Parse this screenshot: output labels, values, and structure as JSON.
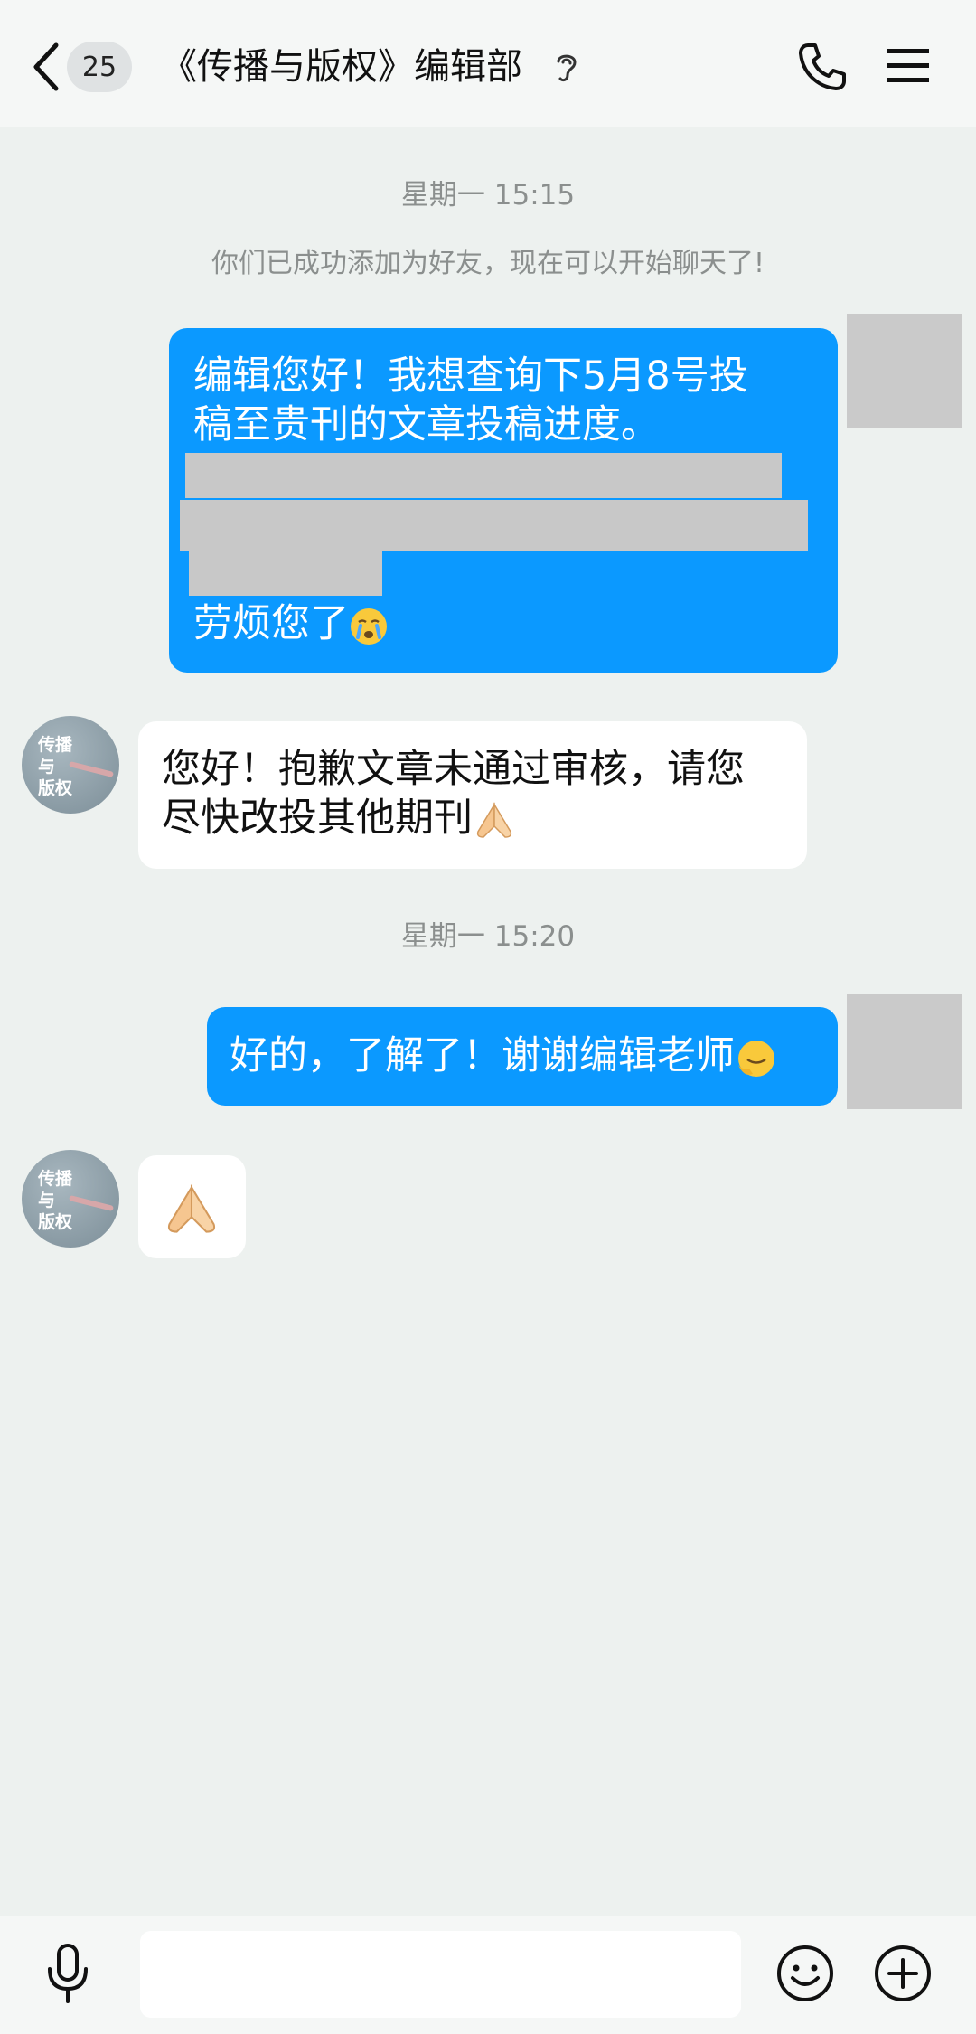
{
  "header": {
    "unread_count": "25",
    "title": "《传播与版权》编辑部"
  },
  "messages": [
    {
      "type": "timestamp",
      "text": "星期一 15:15"
    },
    {
      "type": "system",
      "text": "你们已成功添加为好友，现在可以开始聊天了!"
    },
    {
      "type": "outgoing",
      "lines": [
        "编辑您好！我想查询下5月8号投",
        "稿至贵刊的文章投稿进度。"
      ],
      "closing": "劳烦您了",
      "emoji": "crying-face"
    },
    {
      "type": "incoming",
      "sender_avatar_text": [
        "传播",
        "与",
        "版权"
      ],
      "lines": [
        "您好！抱歉文章未通过审核，请您",
        "尽快改投其他期刊"
      ],
      "emoji": "pray-hands"
    },
    {
      "type": "timestamp",
      "text": "星期一 15:20"
    },
    {
      "type": "outgoing",
      "text": "好的，了解了！谢谢编辑老师",
      "emoji": "smile-face"
    },
    {
      "type": "incoming",
      "sender_avatar_text": [
        "传播",
        "与",
        "版权"
      ],
      "emoji": "pray-hands"
    }
  ],
  "colors": {
    "outgoing_bubble": "#0b99ff",
    "incoming_bubble": "#ffffff",
    "background": "#edf1ef"
  }
}
